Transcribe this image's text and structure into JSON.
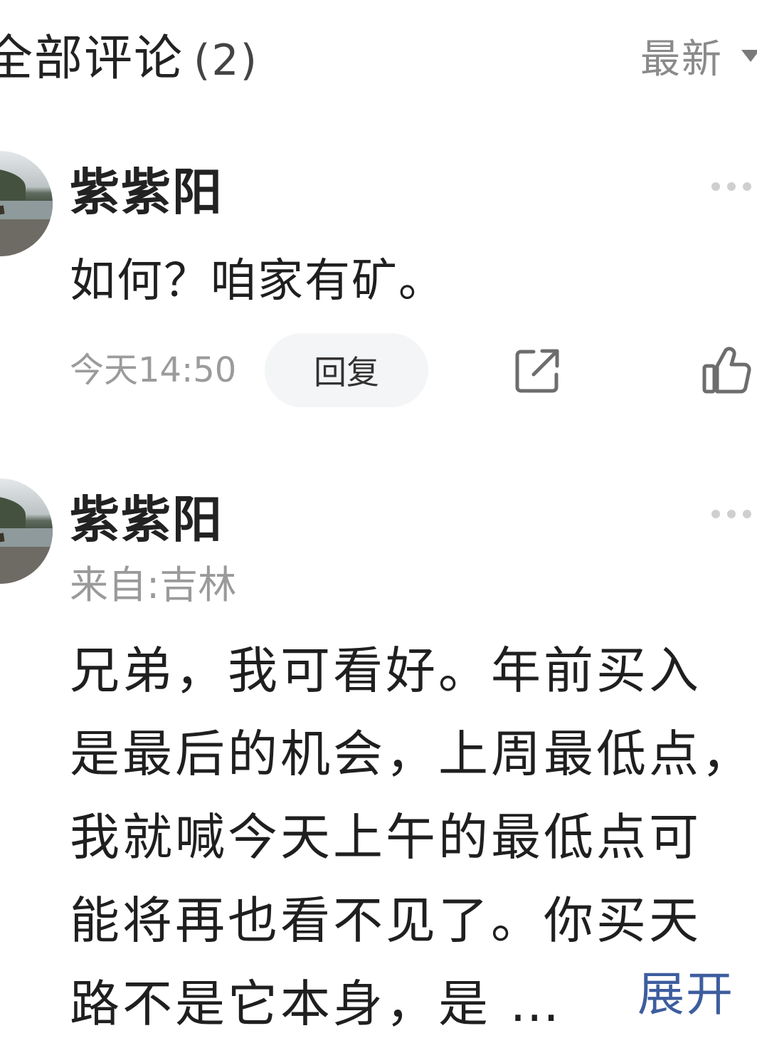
{
  "header": {
    "title": "全部评论",
    "count": "(2)",
    "sort_label": "最新"
  },
  "comments": [
    {
      "username": "紫紫阳",
      "content": "如何？咱家有矿。",
      "timestamp": "今天14:50",
      "reply_label": "回复"
    },
    {
      "username": "紫紫阳",
      "location": "来自:吉林",
      "content_lines": [
        "兄弟，我可看好。年前买入",
        "是最后的机会，上周最低点，",
        "我就喊今天上午的最低点可",
        "能将再也看不见了。你买天",
        "路不是它本身，是 …"
      ],
      "expand_label": "展开"
    }
  ],
  "colors": {
    "link": "#3d5d9e",
    "muted_text": "#9b9b9b",
    "reply_bg": "#f4f5f7"
  },
  "icons": {
    "sort": "caret-down-icon",
    "more": "more-dots-icon",
    "share": "share-icon",
    "like": "thumbs-up-icon"
  }
}
